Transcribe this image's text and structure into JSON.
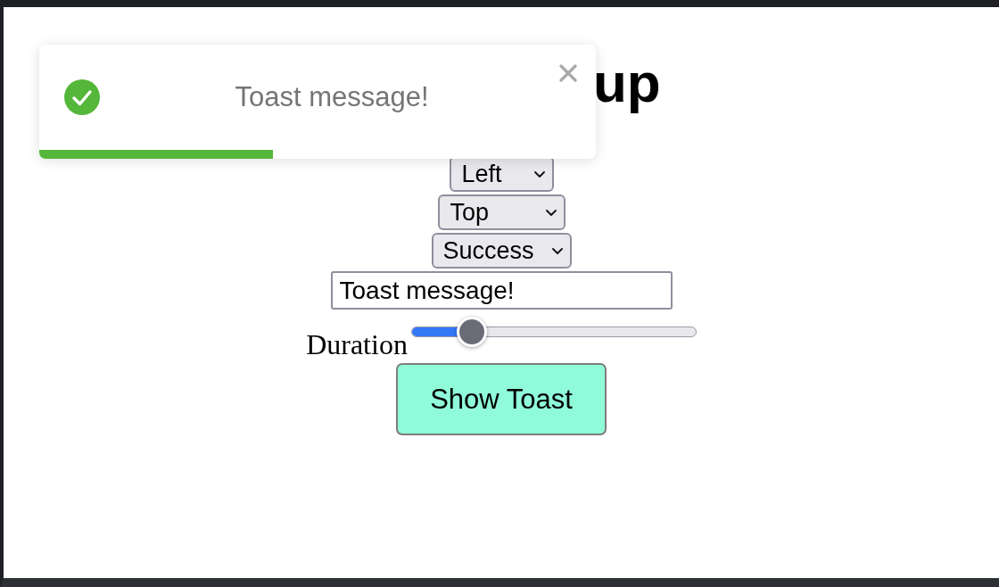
{
  "heading": {
    "text": "up"
  },
  "toast": {
    "kind": "success",
    "message": "Toast message!",
    "level": 0.42
  },
  "controls": [
    {
      "kind": "select",
      "value": "Left"
    },
    {
      "kind": "select",
      "value": "Top"
    },
    {
      "kind": "select",
      "value": "Success"
    },
    {
      "kind": "text",
      "value": "Toast message!"
    },
    {
      "kind": "slider",
      "label": "Duration",
      "level": 0.21
    },
    {
      "kind": "button",
      "label": "Show Toast"
    }
  ]
}
